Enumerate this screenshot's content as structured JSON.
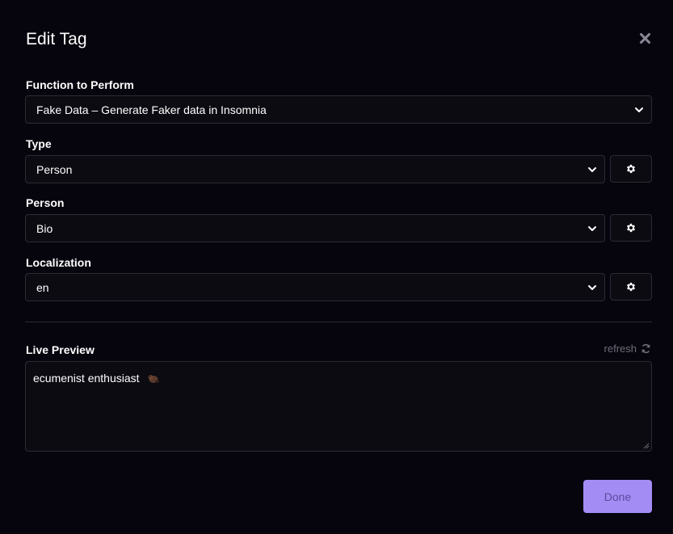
{
  "dialog": {
    "title": "Edit Tag"
  },
  "fields": {
    "function": {
      "label": "Function to Perform",
      "value": "Fake Data – Generate Faker data in Insomnia"
    },
    "type": {
      "label": "Type",
      "value": "Person"
    },
    "person": {
      "label": "Person",
      "value": "Bio"
    },
    "localization": {
      "label": "Localization",
      "value": "en"
    }
  },
  "preview": {
    "label": "Live Preview",
    "refresh_label": "refresh",
    "text": "ecumenist enthusiast"
  },
  "footer": {
    "done_label": "Done"
  },
  "icons": {
    "close": "close-icon",
    "chevron": "chevron-down-icon",
    "settings": "gear-icon",
    "refresh": "refresh-icon"
  },
  "colors": {
    "background": "#06040d",
    "field_bg": "#0c0b12",
    "border": "#2c2a35",
    "primary": "#a48cf5"
  }
}
